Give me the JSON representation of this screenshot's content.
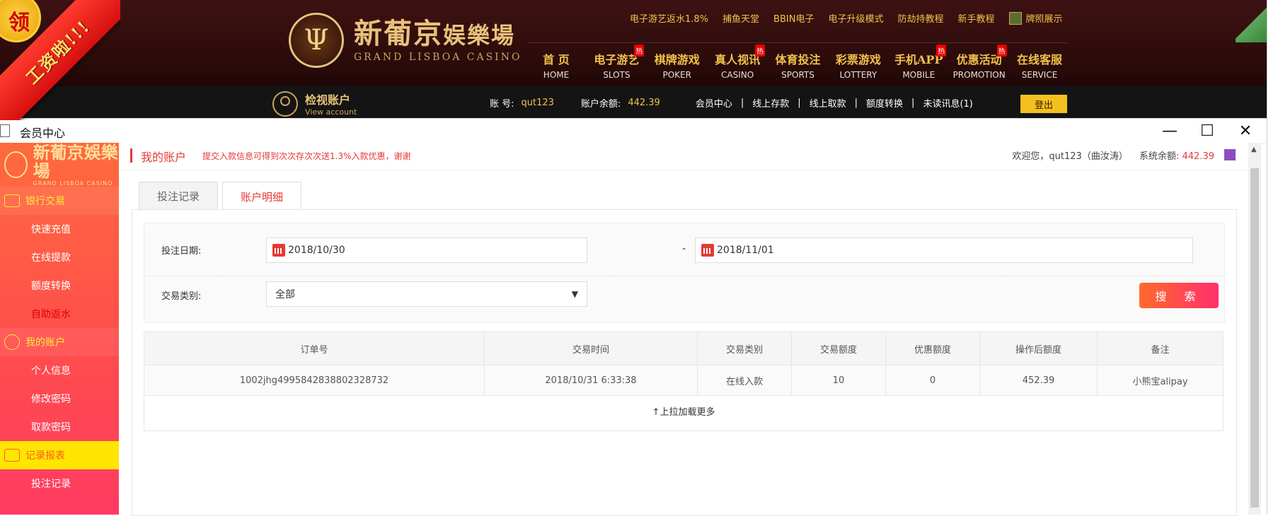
{
  "site": {
    "ribbon_text": "工资啦!!!",
    "seal_text": "领",
    "logo_mark": "Ψ",
    "logo_cn": "新葡京",
    "logo_cn_small": "娱樂場",
    "logo_en": "GRAND LISBOA CASINO",
    "top_links": [
      "电子游艺返水1.8%",
      "捕鱼天堂",
      "BBIN电子",
      "电子升级模式",
      "防劫持教程",
      "新手教程"
    ],
    "license_label": "牌照展示",
    "nav": [
      {
        "cn": "首 页",
        "en": "HOME",
        "hot": ""
      },
      {
        "cn": "电子游艺",
        "en": "SLOTS",
        "hot": "热"
      },
      {
        "cn": "棋牌游戏",
        "en": "POKER",
        "hot": ""
      },
      {
        "cn": "真人视讯",
        "en": "CASINO",
        "hot": "热"
      },
      {
        "cn": "体育投注",
        "en": "SPORTS",
        "hot": ""
      },
      {
        "cn": "彩票游戏",
        "en": "LOTTERY",
        "hot": ""
      },
      {
        "cn": "手机APP",
        "en": "MOBILE",
        "hot": "热"
      },
      {
        "cn": "优惠活动",
        "en": "PROMOTION",
        "hot": "热"
      },
      {
        "cn": "在线客服",
        "en": "SERVICE",
        "hot": ""
      }
    ]
  },
  "account_bar": {
    "view_cn": "检视账户",
    "view_en": "View account",
    "account_label": "账 号:",
    "account_value": "qut123",
    "balance_label": "账户余额:",
    "balance_value": "442.39",
    "links": [
      "会员中心",
      "线上存款",
      "线上取款",
      "额度转换",
      "未读讯息(1)"
    ],
    "logout": "登出"
  },
  "window": {
    "title": "会员中心",
    "minimize": "—",
    "maximize": "☐",
    "close": "✕"
  },
  "sidebar": {
    "logo_cn": "新葡京娛樂場",
    "logo_en": "GRAND LISBOA CASINO",
    "groups": [
      {
        "label": "银行交易",
        "items": [
          {
            "label": "快速充值",
            "active": false
          },
          {
            "label": "在线提款",
            "active": false
          },
          {
            "label": "额度转换",
            "active": false
          },
          {
            "label": "自助返水",
            "active": true
          }
        ]
      },
      {
        "label": "我的账户",
        "items": [
          {
            "label": "个人信息",
            "active": false
          },
          {
            "label": "修改密码",
            "active": false
          },
          {
            "label": "取款密码",
            "active": false
          }
        ]
      },
      {
        "label": "记录报表",
        "items": [
          {
            "label": "投注记录",
            "active": false
          }
        ]
      }
    ]
  },
  "content": {
    "section_title": "我的账户",
    "notice": "提交入款信息可得到次次存次次送1.3%入款优惠，谢谢",
    "welcome": "欢迎您，qut123（曲汝涛）",
    "system_balance_label": "系统余额:",
    "system_balance_value": "442.39",
    "tabs": [
      {
        "label": "投注记录",
        "active": false
      },
      {
        "label": "账户明细",
        "active": true
      }
    ],
    "filter": {
      "date_label": "投注日期:",
      "date_from": "2018/10/30",
      "date_sep": "-",
      "date_to": "2018/11/01",
      "type_label": "交易类别:",
      "type_value": "全部",
      "search_button": "搜 索"
    },
    "table": {
      "headers": [
        "订单号",
        "交易时间",
        "交易类别",
        "交易额度",
        "优惠额度",
        "操作后额度",
        "备注"
      ],
      "rows": [
        [
          "1002jhg4995842838802328732",
          "2018/10/31 6:33:38",
          "在线入款",
          "10",
          "0",
          "452.39",
          "小熊宝alipay"
        ]
      ]
    },
    "load_more": "↑上拉加载更多"
  }
}
